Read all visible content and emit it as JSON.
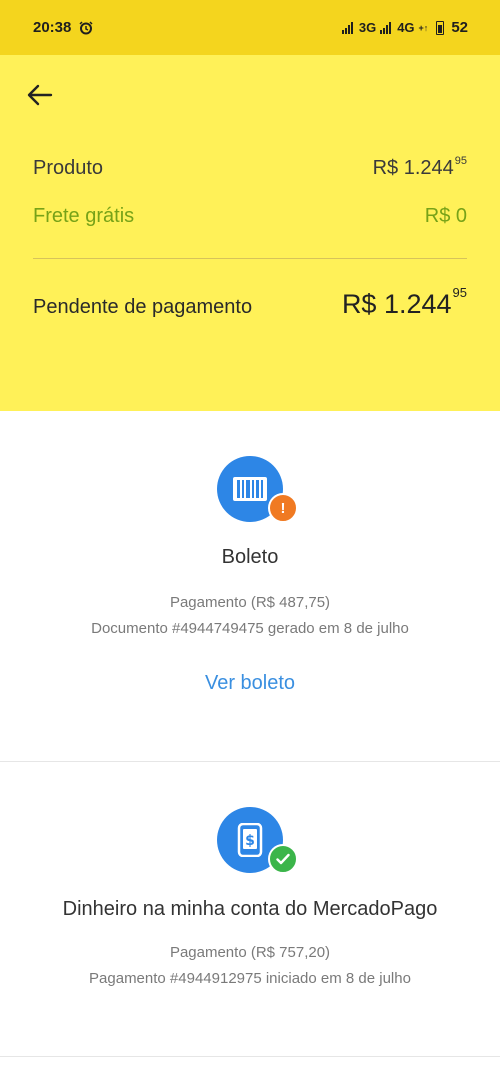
{
  "status_bar": {
    "time": "20:38",
    "network_1": "3G",
    "network_2": "4G",
    "network_2_suffix": "+↑",
    "battery": "52"
  },
  "summary": {
    "product_label": "Produto",
    "product_amount": "R$ 1.244",
    "product_cents": "95",
    "shipping_label": "Frete grátis",
    "shipping_amount": "R$ 0",
    "pending_label": "Pendente de pagamento",
    "pending_amount": "R$ 1.244",
    "pending_cents": "95"
  },
  "payments": [
    {
      "title": "Boleto",
      "line1": "Pagamento (R$ 487,75)",
      "line2": "Documento #4944749475 gerado em 8 de julho",
      "action": "Ver boleto",
      "icon": "barcode-icon",
      "status_icon": "warning-icon",
      "status_color": "#f07a22"
    },
    {
      "title": "Dinheiro na minha conta do MercadoPago",
      "line1": "Pagamento (R$ 757,20)",
      "line2": "Pagamento #4944912975 iniciado em 8 de julho",
      "icon": "phone-money-icon",
      "status_icon": "check-icon",
      "status_color": "#3bb54a"
    }
  ],
  "colors": {
    "status_bar": "#f4d51e",
    "summary_bg": "#fff158",
    "accent_blue": "#2d86e6",
    "free_shipping_green": "#77a218",
    "link_blue": "#3a8fe0"
  }
}
